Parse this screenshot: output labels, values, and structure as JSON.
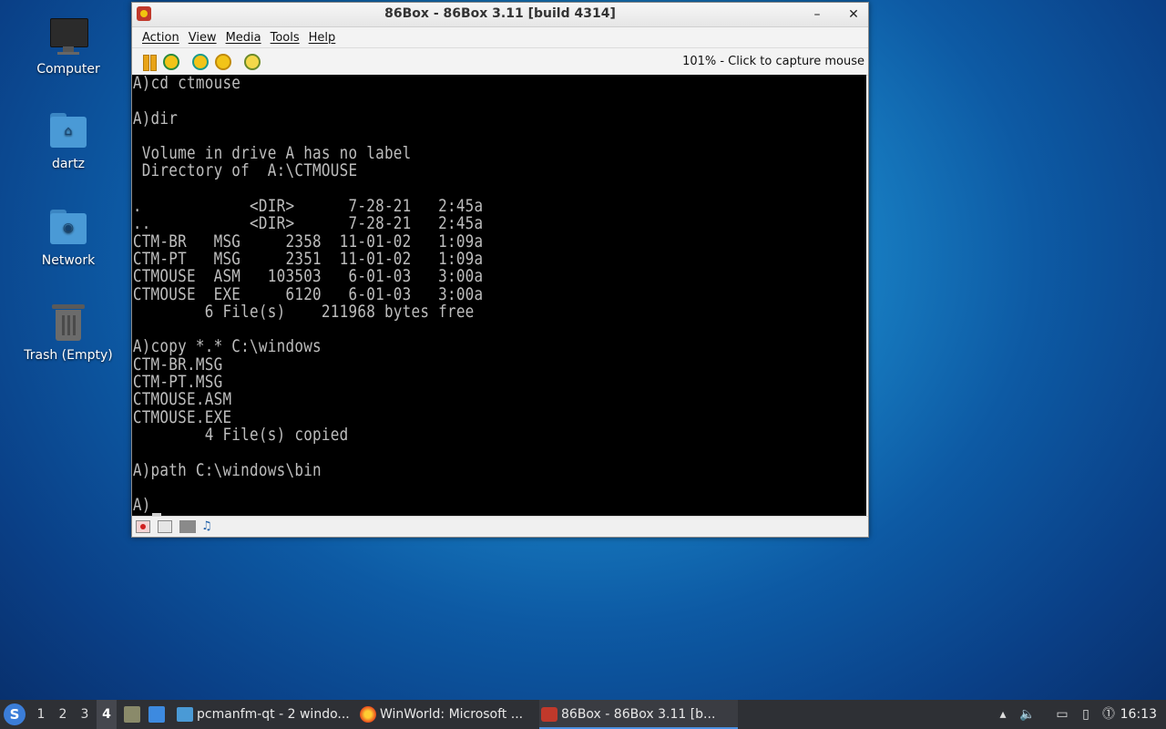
{
  "desktop": {
    "icons": [
      {
        "label": "Computer",
        "icon": "computer-icon"
      },
      {
        "label": "dartz",
        "icon": "home-folder-icon"
      },
      {
        "label": "Network",
        "icon": "network-folder-icon"
      },
      {
        "label": "Trash (Empty)",
        "icon": "trash-icon"
      }
    ]
  },
  "window": {
    "title": "86Box - 86Box 3.11 [build 4314]",
    "minimize_glyph": "–",
    "close_glyph": "✕",
    "menu": [
      "Action",
      "View",
      "Media",
      "Tools",
      "Help"
    ],
    "capture_status": "101% - Click to capture mouse",
    "terminal_text": "A)cd ctmouse\n\nA)dir\n\n Volume in drive A has no label\n Directory of  A:\\CTMOUSE\n\n.            <DIR>      7-28-21   2:45a\n..           <DIR>      7-28-21   2:45a\nCTM-BR   MSG     2358  11-01-02   1:09a\nCTM-PT   MSG     2351  11-01-02   1:09a\nCTMOUSE  ASM   103503   6-01-03   3:00a\nCTMOUSE  EXE     6120   6-01-03   3:00a\n        6 File(s)    211968 bytes free\n\nA)copy *.* C:\\windows\nCTM-BR.MSG\nCTM-PT.MSG\nCTMOUSE.ASM\nCTMOUSE.EXE\n        4 File(s) copied\n\nA)path C:\\windows\\bin\n\nA)"
  },
  "taskbar": {
    "start_glyph": "S",
    "workspaces": [
      "1",
      "2",
      "3",
      "4"
    ],
    "active_workspace": "4",
    "tasks": [
      {
        "label": "pcmanfm-qt - 2 windo...",
        "icon": "folder-icon",
        "active": false
      },
      {
        "label": "WinWorld: Microsoft ...",
        "icon": "firefox-icon",
        "active": false
      },
      {
        "label": "86Box - 86Box 3.11 [b...",
        "icon": "86box-icon",
        "active": true
      }
    ],
    "clock": "16:13"
  }
}
